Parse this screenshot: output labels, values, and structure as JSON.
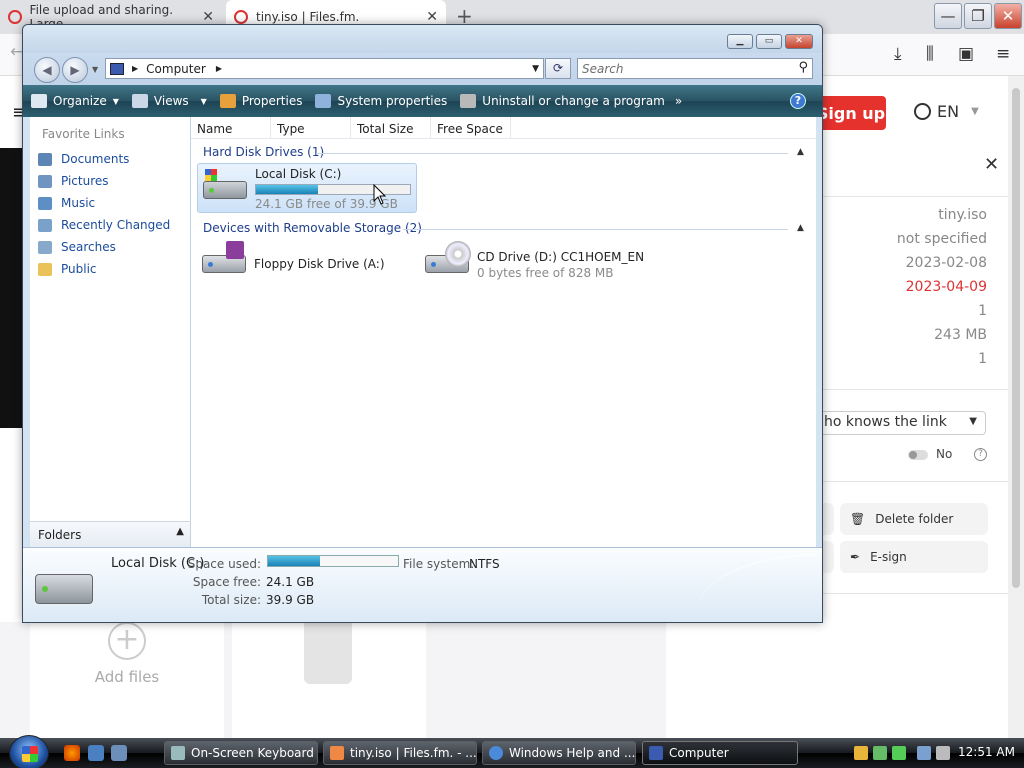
{
  "browser": {
    "tabs": [
      {
        "title": "File upload and sharing. Large"
      },
      {
        "title": "tiny.iso | Files.fm."
      }
    ],
    "signup": "Sign up",
    "language": "EN",
    "file_meta": [
      "tiny.iso",
      "not specified",
      "2023-02-08",
      "2023-04-09",
      "1",
      "243 MB",
      "1"
    ],
    "access_select": "ho knows the link",
    "toggle_label": "No",
    "actions": {
      "delete": "Delete folder",
      "esign": "E-sign"
    },
    "add_files": "Add files"
  },
  "explorer": {
    "address": {
      "location": "Computer"
    },
    "search_placeholder": "Search",
    "commands": {
      "organize": "Organize",
      "views": "Views",
      "properties": "Properties",
      "system_properties": "System properties",
      "uninstall": "Uninstall or change a program",
      "more": "»"
    },
    "favorites": {
      "title": "Favorite Links",
      "items": [
        {
          "label": "Documents",
          "icon": "documents-icon"
        },
        {
          "label": "Pictures",
          "icon": "pictures-icon"
        },
        {
          "label": "Music",
          "icon": "music-icon"
        },
        {
          "label": "Recently Changed",
          "icon": "recently-changed-icon"
        },
        {
          "label": "Searches",
          "icon": "searches-icon"
        },
        {
          "label": "Public",
          "icon": "public-folder-icon"
        }
      ]
    },
    "folders_label": "Folders",
    "columns": [
      "Name",
      "Type",
      "Total Size",
      "Free Space"
    ],
    "groups": {
      "hard_disks": {
        "title": "Hard Disk Drives (1)",
        "drives": [
          {
            "name": "Local Disk (C:)",
            "subtitle": "24.1 GB free of 39.9 GB",
            "used_fraction": 0.4
          }
        ]
      },
      "removable": {
        "title": "Devices with Removable Storage (2)",
        "drives": [
          {
            "name": "Floppy Disk Drive (A:)"
          },
          {
            "name": "CD Drive (D:) CC1HOEM_EN",
            "subtitle": "0 bytes free of 828 MB"
          }
        ]
      }
    },
    "details": {
      "name": "Local Disk (C:)",
      "space_used_label": "Space used:",
      "space_used_fraction": 0.4,
      "space_free_label": "Space free:",
      "space_free": "24.1 GB",
      "total_size_label": "Total size:",
      "total_size": "39.9 GB",
      "fs_label": "File system:",
      "fs": "NTFS"
    }
  },
  "taskbar": {
    "buttons": [
      {
        "label": "On-Screen Keyboard"
      },
      {
        "label": "tiny.iso | Files.fm. - ..."
      },
      {
        "label": "Windows Help and ..."
      },
      {
        "label": "Computer"
      }
    ],
    "clock": "12:51 AM"
  }
}
